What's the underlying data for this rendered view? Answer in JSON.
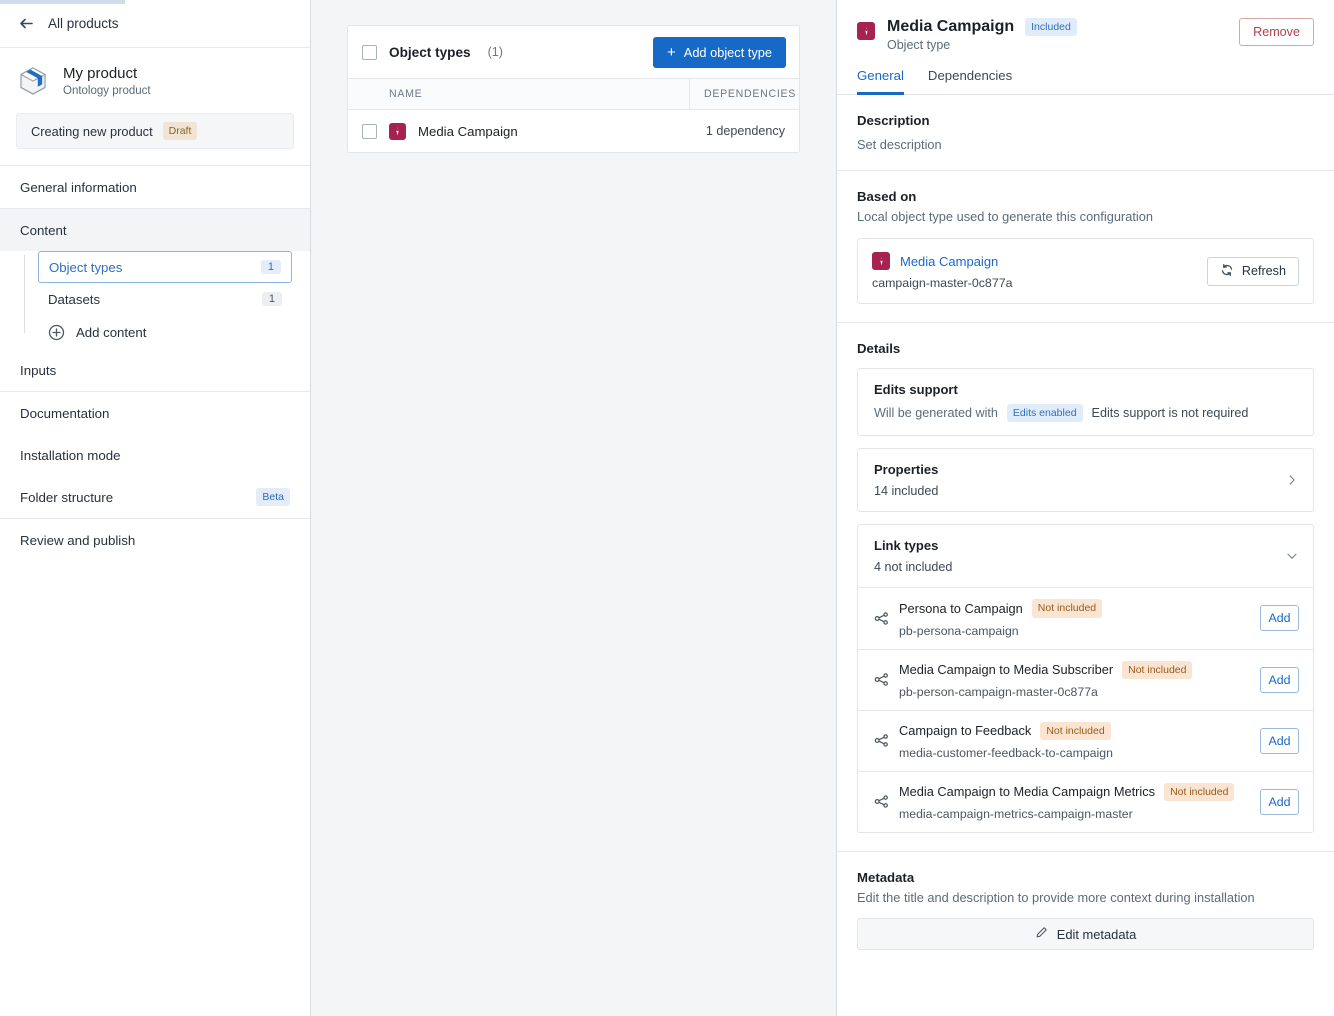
{
  "sidebar": {
    "back_label": "All products",
    "back_icon": "arrow-left-icon",
    "product_icon": "package-box-icon",
    "product_name": "My product",
    "product_subtitle": "Ontology product",
    "status_text": "Creating new product",
    "status_badge": "Draft",
    "nav": [
      {
        "label": "General information"
      },
      {
        "label": "Content"
      }
    ],
    "content_children": [
      {
        "label": "Object types",
        "count": "1",
        "selected": true
      },
      {
        "label": "Datasets",
        "count": "1",
        "selected": false
      }
    ],
    "add_content_label": "Add content",
    "add_content_icon": "plus-circle-icon",
    "nav_after": [
      {
        "label": "Inputs",
        "badge": ""
      },
      {
        "label": "Documentation",
        "badge": ""
      },
      {
        "label": "Installation mode",
        "badge": ""
      },
      {
        "label": "Folder structure",
        "badge": "Beta"
      },
      {
        "label": "Review and publish",
        "badge": ""
      }
    ]
  },
  "center": {
    "title": "Object types",
    "count": "(1)",
    "add_button": "Add object type",
    "add_button_icon": "plus-icon",
    "columns": [
      "NAME",
      "DEPENDENCIES"
    ],
    "rows": [
      {
        "name": "Media Campaign",
        "icon": "object-type-icon",
        "dependencies": "1 dependency"
      }
    ]
  },
  "right": {
    "icon": "object-type-icon",
    "title": "Media Campaign",
    "status_badge": "Included",
    "subtitle": "Object type",
    "remove_button": "Remove",
    "tabs": [
      {
        "label": "General",
        "active": true
      },
      {
        "label": "Dependencies",
        "active": false
      }
    ],
    "description": {
      "heading": "Description",
      "value": "Set description"
    },
    "based_on": {
      "heading": "Based on",
      "subtitle": "Local object type used to generate this configuration",
      "link_name": "Media Campaign",
      "link_icon": "object-type-icon",
      "rid": "campaign-master-0c877a",
      "refresh_button": "Refresh",
      "refresh_icon": "refresh-icon"
    },
    "details": {
      "heading": "Details",
      "edits_support": {
        "title": "Edits support",
        "prefix": "Will be generated with",
        "badge": "Edits enabled",
        "suffix": "Edits support is not required"
      },
      "properties": {
        "title": "Properties",
        "subtitle": "14 included",
        "chevron": "chevron-right-icon"
      },
      "link_types": {
        "title": "Link types",
        "subtitle": "4 not included",
        "chevron": "chevron-down-icon",
        "items": [
          {
            "name": "Persona to Campaign",
            "badge": "Not included",
            "rid": "pb-persona-campaign",
            "action": "Add",
            "icon": "link-type-icon"
          },
          {
            "name": "Media Campaign to Media Subscriber",
            "badge": "Not included",
            "rid": "pb-person-campaign-master-0c877a",
            "action": "Add",
            "icon": "link-type-icon"
          },
          {
            "name": "Campaign to Feedback",
            "badge": "Not included",
            "rid": "media-customer-feedback-to-campaign",
            "action": "Add",
            "icon": "link-type-icon"
          },
          {
            "name": "Media Campaign to Media Campaign Metrics",
            "badge": "Not included",
            "rid": "media-campaign-metrics-campaign-master",
            "action": "Add",
            "icon": "link-type-icon"
          }
        ]
      }
    },
    "metadata": {
      "heading": "Metadata",
      "subtitle": "Edit the title and description to provide more context during installation",
      "button": "Edit metadata",
      "button_icon": "pencil-icon"
    }
  },
  "colors": {
    "accent_blue": "#1769c8",
    "object_type_crimson": "#a52251",
    "remove_red": "#b4404a",
    "draft_amber": "#8a6220",
    "not_included_orange": "#9c5a1c"
  }
}
